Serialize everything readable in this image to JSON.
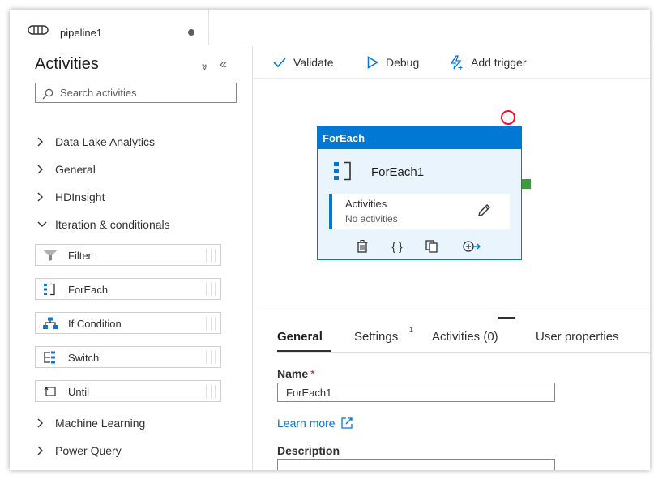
{
  "tab": {
    "title": "pipeline1",
    "icon": "pipeline-icon",
    "unsaved_indicator": "dot"
  },
  "activities_panel": {
    "title": "Activities",
    "search_placeholder": "Search activities",
    "categories": [
      {
        "label": "Data Lake Analytics",
        "expanded": false
      },
      {
        "label": "General",
        "expanded": false
      },
      {
        "label": "HDInsight",
        "expanded": false
      },
      {
        "label": "Iteration & conditionals",
        "expanded": true
      },
      {
        "label": "Machine Learning",
        "expanded": false
      },
      {
        "label": "Power Query",
        "expanded": false
      }
    ],
    "items": [
      {
        "label": "Filter",
        "icon": "filter-icon"
      },
      {
        "label": "ForEach",
        "icon": "foreach-icon"
      },
      {
        "label": "If Condition",
        "icon": "if-condition-icon"
      },
      {
        "label": "Switch",
        "icon": "switch-icon"
      },
      {
        "label": "Until",
        "icon": "until-icon"
      }
    ]
  },
  "toolbar": {
    "validate": "Validate",
    "debug": "Debug",
    "add_trigger": "Add trigger"
  },
  "node": {
    "type": "ForEach",
    "name": "ForEach1",
    "inner_title": "Activities",
    "inner_subtitle": "No activities"
  },
  "properties": {
    "tabs": [
      {
        "label": "General",
        "active": true
      },
      {
        "label": "Settings",
        "badge": "1"
      },
      {
        "label": "Activities (0)"
      },
      {
        "label": "User properties"
      }
    ],
    "name_label": "Name",
    "name_required": "*",
    "name_value": "ForEach1",
    "learn_more": "Learn more",
    "description_label": "Description"
  },
  "colors": {
    "accent": "#0078d4",
    "node_background": "#e9f4fd",
    "success_handle": "#3a9c3a",
    "error_handle": "#e81123"
  }
}
